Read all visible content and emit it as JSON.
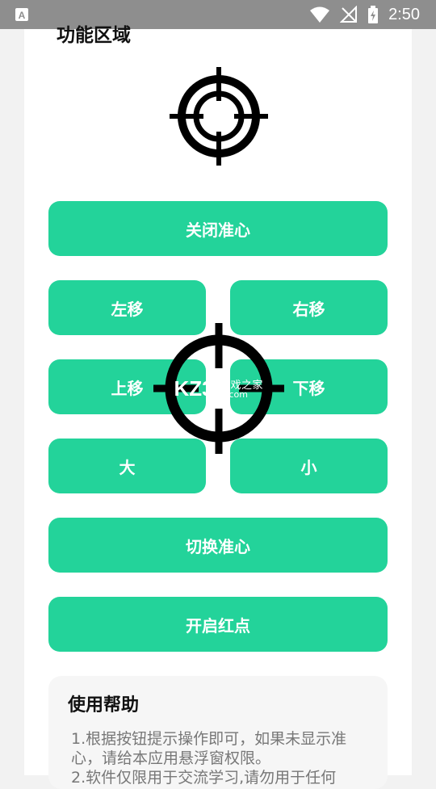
{
  "status_bar": {
    "time": "2:50",
    "left_icon": "a-notification-icon",
    "icons": [
      "wifi-icon",
      "no-signal-icon",
      "battery-icon"
    ]
  },
  "section": {
    "title": "功能区域"
  },
  "buttons": {
    "toggle_crosshair": "关闭准心",
    "move_left": "左移",
    "move_right": "右移",
    "move_up": "上移",
    "move_down": "下移",
    "bigger": "大",
    "smaller": "小",
    "switch_crosshair": "切换准心",
    "red_dot": "开启红点"
  },
  "help": {
    "title": "使用帮助",
    "text_line1": "1.根据按钮提示操作即可，如果未显示准心，请给本应用悬浮窗权限。",
    "text_line2": "2.软件仅限用于交流学习,请勿用于任何"
  },
  "watermark": {
    "logo_text": "KZ3",
    "site_name": "游戏之家",
    "site_domain": ".com"
  },
  "colors": {
    "accent": "#23d39a",
    "status_bar": "#8e8e8e",
    "card": "#ffffff",
    "help_bg": "#f6f6f6"
  }
}
